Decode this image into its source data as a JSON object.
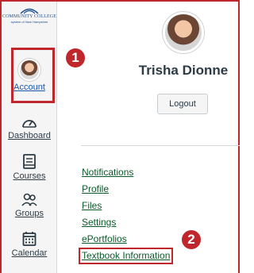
{
  "logo": {
    "name": "COMMUNITY COLLEGE",
    "subtitle": "system of New Hampshire"
  },
  "sidebar": {
    "items": [
      {
        "label": "Account",
        "icon": "user-avatar"
      },
      {
        "label": "Dashboard",
        "icon": "speedometer-icon"
      },
      {
        "label": "Courses",
        "icon": "book-icon"
      },
      {
        "label": "Groups",
        "icon": "group-icon"
      },
      {
        "label": "Calendar",
        "icon": "calendar-icon"
      }
    ]
  },
  "callouts": {
    "one": "1",
    "two": "2"
  },
  "profile": {
    "name": "Trisha Dionne",
    "logout_label": "Logout",
    "links": [
      "Notifications",
      "Profile",
      "Files",
      "Settings",
      "ePortfolios",
      "Textbook Information"
    ]
  },
  "colors": {
    "highlight": "#c0272d",
    "link": "#0b5a2a",
    "nav_text": "#2d3b45"
  }
}
